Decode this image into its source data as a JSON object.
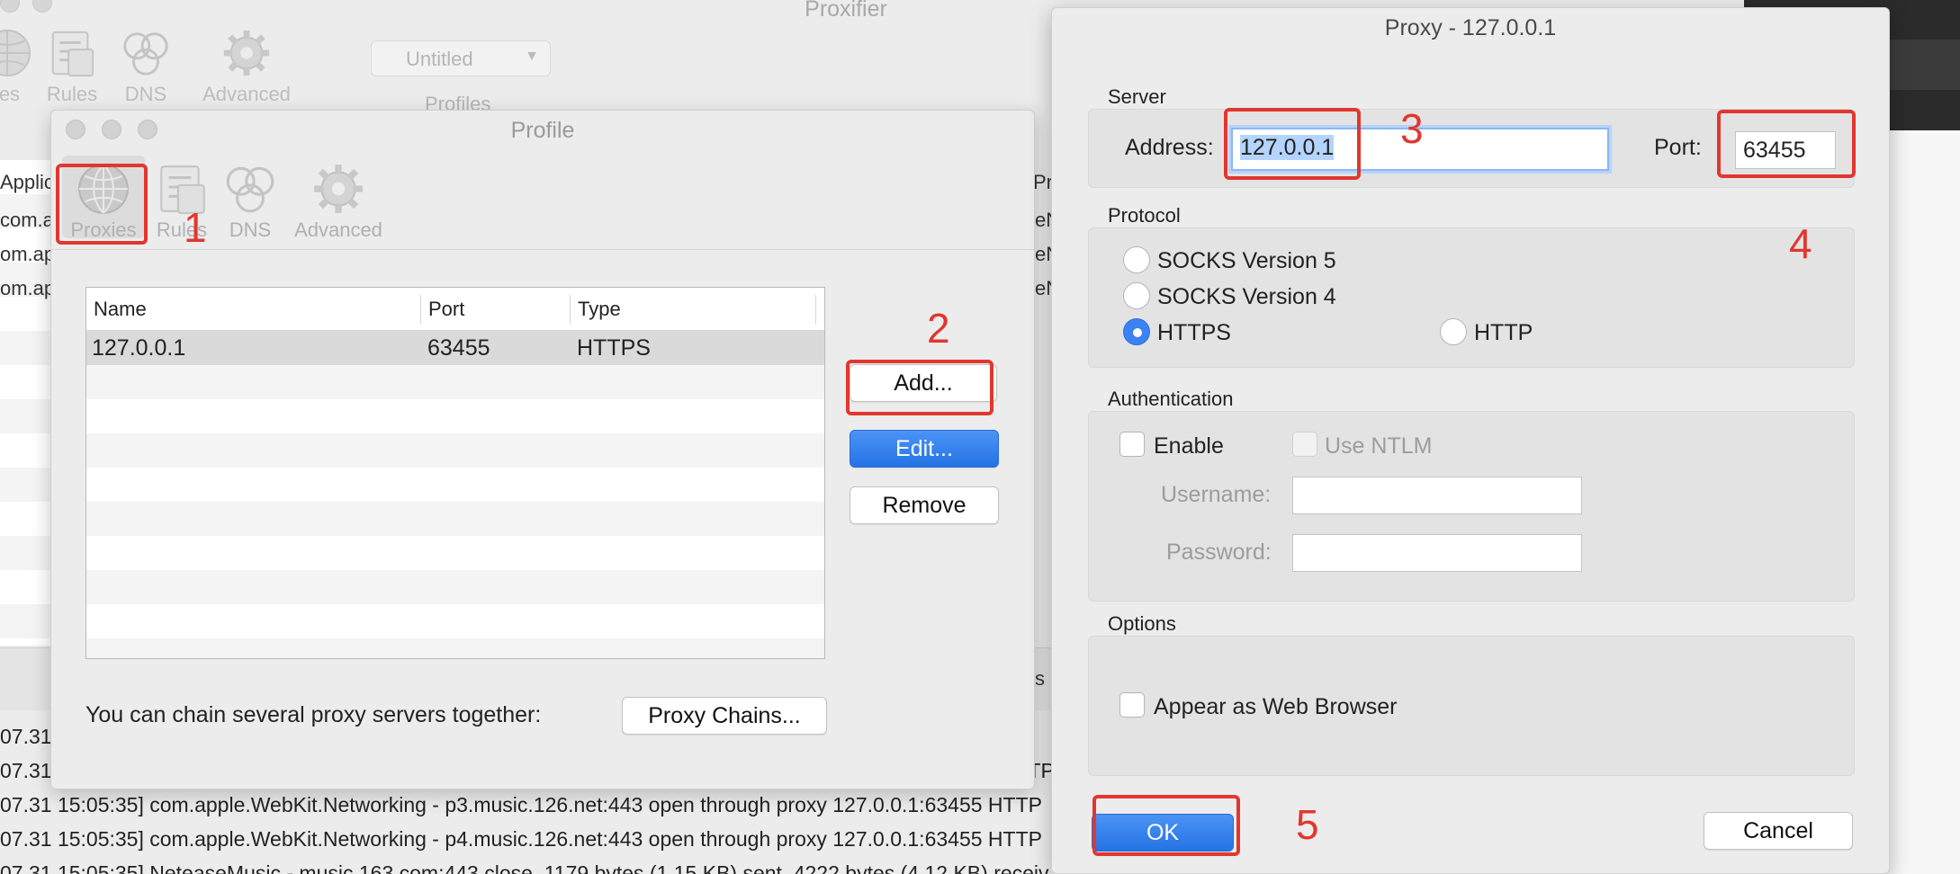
{
  "background_window": {
    "title": "Proxifier",
    "toolbar": [
      {
        "label": "ies",
        "icon": "globe-icon"
      },
      {
        "label": "Rules",
        "icon": "rules-icon"
      },
      {
        "label": "DNS",
        "icon": "dns-icon"
      },
      {
        "label": "Advanced",
        "icon": "gear-icon"
      }
    ],
    "profile_select": "Untitled",
    "profiles_label": "Profiles",
    "col_header_left": "Applic",
    "col_header_right": "Pr",
    "rows_left": [
      "com.ap",
      "om.ap",
      "om.ap"
    ],
    "rows_right": [
      "eN",
      "eN",
      "eN"
    ],
    "status_right_fragment": "s",
    "log_lines": [
      "07.31",
      "07.31",
      "07.31 15:05:35] com.apple.WebKit.Networking - p3.music.126.net:443 open through proxy 127.0.0.1:63455 HTTP",
      "07.31 15:05:35] com.apple.WebKit.Networking - p4.music.126.net:443 open through proxy 127.0.0.1:63455 HTTP",
      "07.31 15:05:35] NeteaseMusic - music.163.com:443 close, 1179 bytes (1.15 KB) sent, 4222 bytes (4.12 KB) receiv"
    ],
    "log_right_fragment_1": "ITP",
    "log_right_fragment_2": "TP"
  },
  "profile_dialog": {
    "title": "Profile",
    "toolbar": [
      {
        "label": "Proxies",
        "icon": "globe-icon",
        "selected": true
      },
      {
        "label": "Rules",
        "icon": "rules-icon"
      },
      {
        "label": "DNS",
        "icon": "dns-icon"
      },
      {
        "label": "Advanced",
        "icon": "gear-icon"
      }
    ],
    "table": {
      "columns": [
        "Name",
        "Port",
        "Type"
      ],
      "rows": [
        {
          "name": "127.0.0.1",
          "port": "63455",
          "type": "HTTPS"
        }
      ]
    },
    "buttons": {
      "add": "Add...",
      "edit": "Edit...",
      "remove": "Remove"
    },
    "chain_text": "You can chain several proxy servers together:",
    "chain_button": "Proxy Chains..."
  },
  "proxy_dialog": {
    "title": "Proxy - 127.0.0.1",
    "server": {
      "section": "Server",
      "address_label": "Address:",
      "address_value": "127.0.0.1",
      "port_label": "Port:",
      "port_value": "63455"
    },
    "protocol": {
      "section": "Protocol",
      "options": [
        "SOCKS Version 5",
        "SOCKS Version 4",
        "HTTPS",
        "HTTP"
      ],
      "selected": "HTTPS"
    },
    "authentication": {
      "section": "Authentication",
      "enable_label": "Enable",
      "ntlm_label": "Use NTLM",
      "username_label": "Username:",
      "password_label": "Password:",
      "username_value": "",
      "password_value": ""
    },
    "options": {
      "section": "Options",
      "browser_label": "Appear as Web Browser"
    },
    "ok_label": "OK",
    "cancel_label": "Cancel"
  },
  "annotations": [
    "1",
    "2",
    "3",
    "4",
    "5"
  ],
  "colors": {
    "annotation_red": "#e1372f",
    "accent_blue": "#2573e5",
    "selection_blue": "#b4d4fd"
  }
}
